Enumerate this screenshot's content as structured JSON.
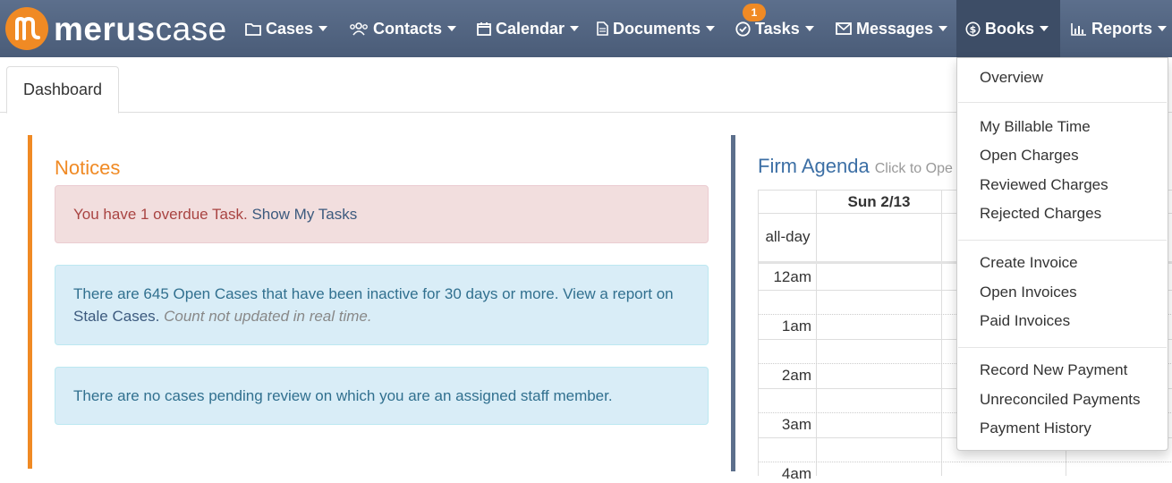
{
  "brand": {
    "bold": "merus",
    "light": "case"
  },
  "nav": {
    "cases": "Cases",
    "contacts": "Contacts",
    "calendar": "Calendar",
    "documents": "Documents",
    "tasks": "Tasks",
    "tasks_badge": "1",
    "messages": "Messages",
    "books": "Books",
    "reports": "Reports"
  },
  "tabs": {
    "dashboard": "Dashboard"
  },
  "notices": {
    "title": "Notices",
    "overdue_text": "You have 1 overdue Task.",
    "overdue_link": "Show My Tasks",
    "stale_text": "There are 645 Open Cases that have been inactive for 30 days or more. View a report on",
    "stale_link": "Stale Cases.",
    "stale_note": "Count not updated in real time.",
    "review_text": "There are no cases pending review on which you are an assigned staff member."
  },
  "agenda": {
    "title": "Firm Agenda",
    "subtitle": "Click to Ope",
    "day_header": "Sun 2/13",
    "allday": "all-day",
    "times": [
      "12am",
      "1am",
      "2am",
      "3am",
      "4am"
    ]
  },
  "books_menu": {
    "overview": "Overview",
    "my_billable_time": "My Billable Time",
    "open_charges": "Open Charges",
    "reviewed_charges": "Reviewed Charges",
    "rejected_charges": "Rejected Charges",
    "create_invoice": "Create Invoice",
    "open_invoices": "Open Invoices",
    "paid_invoices": "Paid Invoices",
    "record_new_payment": "Record New Payment",
    "unreconciled_payments": "Unreconciled Payments",
    "payment_history": "Payment History"
  },
  "colors": {
    "navbar": "#5c6f8c",
    "accent_orange": "#f08a24",
    "danger_bg": "#f2dede",
    "info_bg": "#d9edf7"
  },
  "icons": {
    "cases": "folder-icon",
    "contacts": "users-icon",
    "calendar": "calendar-icon",
    "documents": "document-icon",
    "tasks": "check-circle-icon",
    "messages": "envelope-icon",
    "books": "dollar-circle-icon",
    "reports": "bar-chart-icon"
  }
}
